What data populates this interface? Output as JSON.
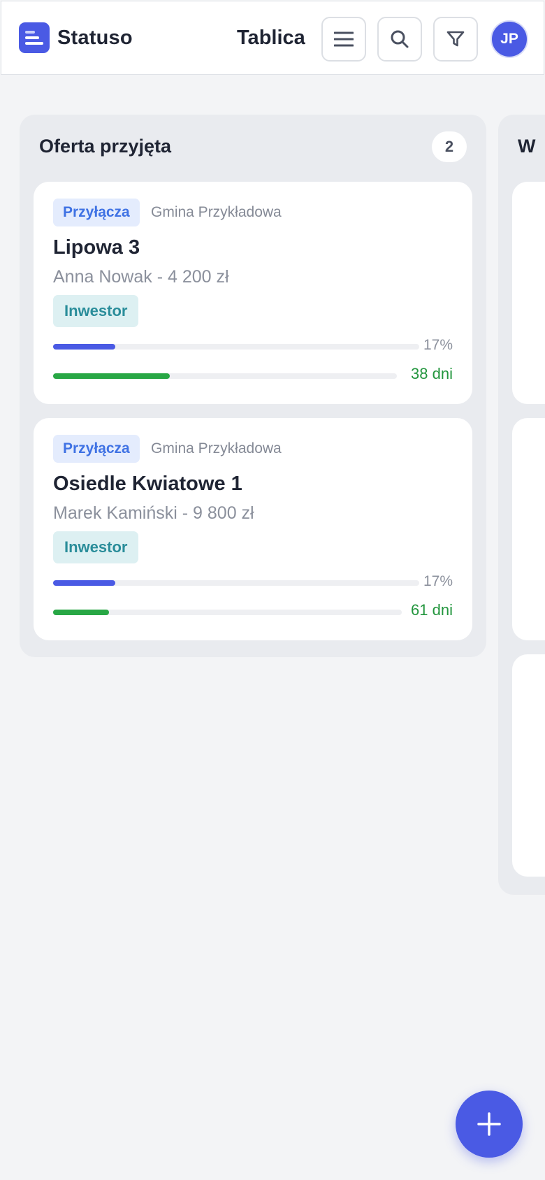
{
  "app": {
    "name": "Statuso"
  },
  "header": {
    "title": "Tablica",
    "menu_icon": "hamburger-menu-icon",
    "search_icon": "search-icon",
    "filter_icon": "filter-icon",
    "avatar_initials": "JP"
  },
  "columns": [
    {
      "title": "Oferta przyjęta",
      "count": "2",
      "cards": [
        {
          "category": "Przyłącza",
          "municipality": "Gmina Przykładowa",
          "title": "Lipowa 3",
          "subtitle": "Anna Nowak - 4 200 zł",
          "role": "Inwestor",
          "progress_percent": 17,
          "progress_label": "17%",
          "time_fraction": 0.34,
          "days_label": "38 dni"
        },
        {
          "category": "Przyłącza",
          "municipality": "Gmina Przykładowa",
          "title": "Osiedle Kwiatowe 1",
          "subtitle": "Marek Kamiński - 9 800 zł",
          "role": "Inwestor",
          "progress_percent": 17,
          "progress_label": "17%",
          "time_fraction": 0.16,
          "days_label": "61 dni"
        }
      ]
    },
    {
      "title": "W"
    }
  ],
  "fab": {
    "icon": "plus-icon"
  },
  "colors": {
    "accent": "#4a5ae4",
    "tag_bg": "#e4ecfd",
    "tag_text": "#3f72e4",
    "role_bg": "#ddf0f2",
    "role_text": "#2a8d9a",
    "days_green": "#23963e"
  }
}
